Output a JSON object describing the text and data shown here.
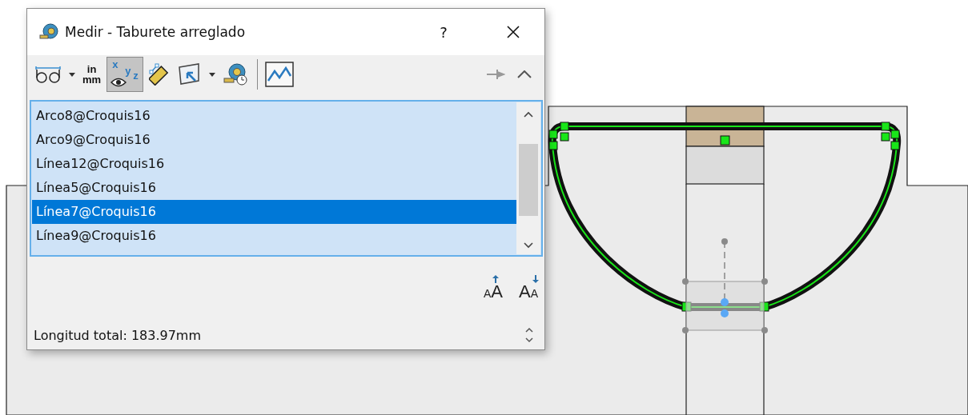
{
  "window": {
    "title": "Medir - Taburete arreglado",
    "help": "?"
  },
  "toolbar": [
    {
      "kind": "arc",
      "selected": false
    },
    {
      "kind": "caret",
      "selected": false
    },
    {
      "kind": "units",
      "selected": false,
      "top": "in",
      "bottom": "mm"
    },
    {
      "kind": "xyz",
      "selected": true,
      "letters": [
        "x",
        "y",
        "z"
      ]
    },
    {
      "kind": "ruler",
      "selected": false
    },
    {
      "kind": "select",
      "selected": false
    },
    {
      "kind": "caret",
      "selected": false
    },
    {
      "kind": "history",
      "selected": false
    },
    {
      "kind": "separator"
    },
    {
      "kind": "graph",
      "selected": false
    }
  ],
  "list": [
    {
      "text": "Arco8@Croquis16",
      "selected": false
    },
    {
      "text": "Arco9@Croquis16",
      "selected": false
    },
    {
      "text": "Línea12@Croquis16",
      "selected": false
    },
    {
      "text": "Línea5@Croquis16",
      "selected": false
    },
    {
      "text": "Línea7@Croquis16",
      "selected": true
    },
    {
      "text": "Línea9@Croquis16",
      "selected": false
    }
  ],
  "font_buttons": [
    {
      "kind": "increase",
      "small": "A",
      "large": "A"
    },
    {
      "kind": "decrease",
      "small": "A",
      "large": "A"
    }
  ],
  "status": "Longitud total: 183.97mm"
}
